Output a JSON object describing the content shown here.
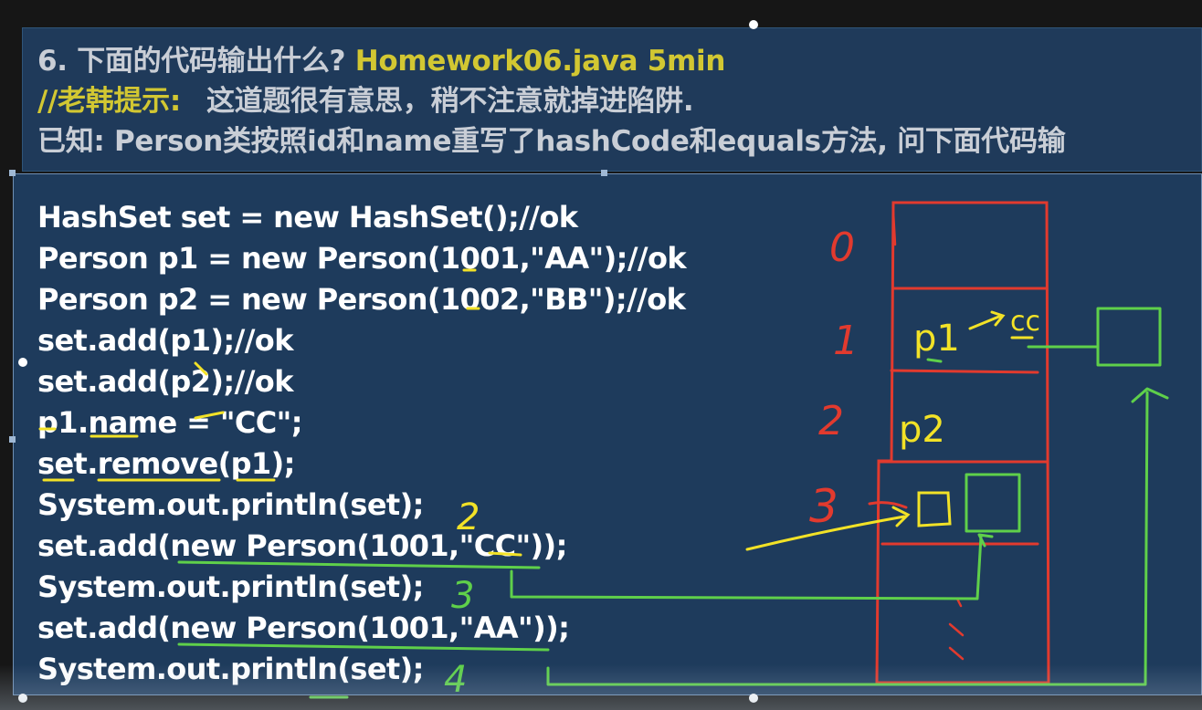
{
  "header": {
    "title_prefix": "6. 下面的代码输出什么?",
    "title_file": "Homework06.java 5min",
    "hint_label": "//老韩提示:",
    "hint_text": "这道题很有意思，稍不注意就掉进陷阱.",
    "known_text": "已知: Person类按照id和name重写了hashCode和equals方法, 问下面代码输"
  },
  "code_lines": [
    "HashSet set = new HashSet();//ok",
    "Person p1 = new Person(1001,\"AA\");//ok",
    "Person p2 = new Person(1002,\"BB\");//ok",
    "set.add(p1);//ok",
    "set.add(p2);//ok",
    "p1.name = \"CC\";",
    "set.remove(p1);",
    "System.out.println(set);",
    "set.add(new Person(1001,\"CC\"));",
    "System.out.println(set);",
    "set.add(new Person(1001,\"AA\"));",
    "System.out.println(set);"
  ],
  "annotations": {
    "index_0": "0",
    "index_1": "1",
    "index_2": "2",
    "index_3": "3",
    "cell_p1": "p1",
    "cell_p1_cc": "cc",
    "cell_p2": "p2",
    "count_after_remove": "2",
    "count_after_add_cc": "3",
    "count_after_add_aa": "4"
  },
  "colors": {
    "header_bg": "#1f3a5a",
    "code_bg": "#1e3b5c",
    "accent_yellow": "#d2c732",
    "ink_red": "#e23a2e",
    "ink_yellow": "#f2e227",
    "ink_green": "#5fd04a"
  }
}
